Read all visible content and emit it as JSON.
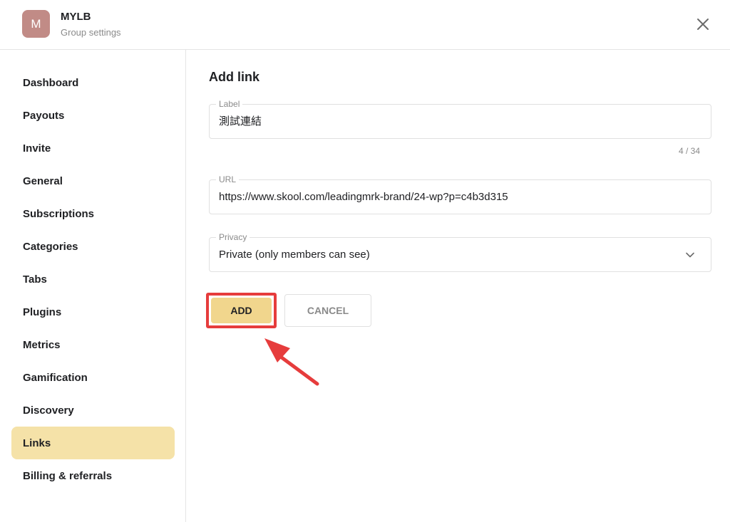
{
  "header": {
    "avatar_letter": "M",
    "group_name": "MYLB",
    "subtitle": "Group settings",
    "close_icon": "close-icon"
  },
  "sidebar": {
    "items": [
      {
        "label": "Dashboard",
        "active": false
      },
      {
        "label": "Payouts",
        "active": false
      },
      {
        "label": "Invite",
        "active": false
      },
      {
        "label": "General",
        "active": false
      },
      {
        "label": "Subscriptions",
        "active": false
      },
      {
        "label": "Categories",
        "active": false
      },
      {
        "label": "Tabs",
        "active": false
      },
      {
        "label": "Plugins",
        "active": false
      },
      {
        "label": "Metrics",
        "active": false
      },
      {
        "label": "Gamification",
        "active": false
      },
      {
        "label": "Discovery",
        "active": false
      },
      {
        "label": "Links",
        "active": true
      },
      {
        "label": "Billing & referrals",
        "active": false
      }
    ]
  },
  "form": {
    "title": "Add link",
    "label_field": {
      "label": "Label",
      "value": "測試連結"
    },
    "label_counter": "4 / 34",
    "url_field": {
      "label": "URL",
      "value": "https://www.skool.com/leadingmrk-brand/24-wp?p=c4b3d315"
    },
    "privacy_field": {
      "label": "Privacy",
      "value": "Private (only members can see)",
      "icon": "chevron-down-icon"
    },
    "add_label": "ADD",
    "cancel_label": "CANCEL"
  },
  "colors": {
    "active_nav": "#f5e2a8",
    "add_button": "#f1d68d",
    "highlight": "#e63c3c",
    "avatar": "#c18b86"
  }
}
